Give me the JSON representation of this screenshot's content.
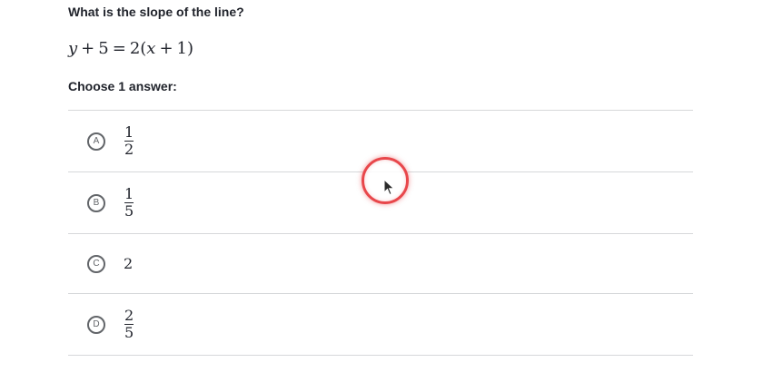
{
  "question": {
    "text": "What is the slope of the line?"
  },
  "equation": {
    "y": "y",
    "plus1": "+",
    "five": "5",
    "eq": "=",
    "two": "2(",
    "x": "x",
    "plus2": "+",
    "one": "1",
    "close": ")"
  },
  "prompt": "Choose 1 answer:",
  "choices": [
    {
      "letter": "A",
      "numerator": "1",
      "denominator": "2"
    },
    {
      "letter": "B",
      "numerator": "1",
      "denominator": "5"
    },
    {
      "letter": "C",
      "value": "2"
    },
    {
      "letter": "D",
      "numerator": "2",
      "denominator": "5"
    }
  ],
  "colors": {
    "text": "#21242c",
    "divider": "#d6d8da",
    "choice_circle": "#626569",
    "cursor_highlight": "#e8474b"
  },
  "icons": {
    "cursor": "mouse-pointer-icon"
  }
}
